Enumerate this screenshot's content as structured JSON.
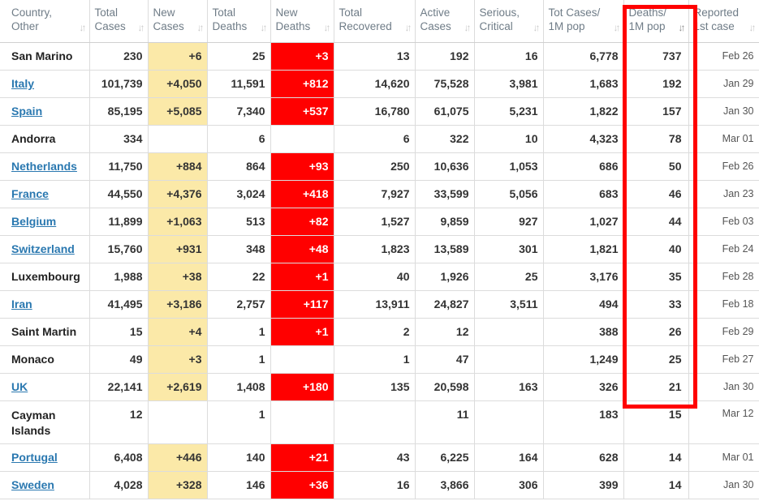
{
  "columns": [
    {
      "key": "country",
      "label": "Country,\nOther"
    },
    {
      "key": "total_cases",
      "label": "Total\nCases"
    },
    {
      "key": "new_cases",
      "label": "New\nCases"
    },
    {
      "key": "total_deaths",
      "label": "Total\nDeaths"
    },
    {
      "key": "new_deaths",
      "label": "New\nDeaths"
    },
    {
      "key": "total_recovered",
      "label": "Total\nRecovered"
    },
    {
      "key": "active_cases",
      "label": "Active\nCases"
    },
    {
      "key": "serious_critical",
      "label": "Serious,\nCritical"
    },
    {
      "key": "tot_cases_1m",
      "label": "Tot Cases/\n1M pop"
    },
    {
      "key": "deaths_1m",
      "label": "Deaths/\n1M pop"
    },
    {
      "key": "reported",
      "label": "Reported\n1st case"
    }
  ],
  "sorted_column": "deaths_1m",
  "highlight_color": "#ff0000",
  "new_cases_color": "#fbe9a8",
  "new_deaths_color": "#ff0000",
  "rows": [
    {
      "country": "San Marino",
      "link": false,
      "total_cases": "230",
      "new_cases": "+6",
      "total_deaths": "25",
      "new_deaths": "+3",
      "total_recovered": "13",
      "active_cases": "192",
      "serious_critical": "16",
      "tot_cases_1m": "6,778",
      "deaths_1m": "737",
      "reported": "Feb 26"
    },
    {
      "country": "Italy",
      "link": true,
      "total_cases": "101,739",
      "new_cases": "+4,050",
      "total_deaths": "11,591",
      "new_deaths": "+812",
      "total_recovered": "14,620",
      "active_cases": "75,528",
      "serious_critical": "3,981",
      "tot_cases_1m": "1,683",
      "deaths_1m": "192",
      "reported": "Jan 29"
    },
    {
      "country": "Spain",
      "link": true,
      "total_cases": "85,195",
      "new_cases": "+5,085",
      "total_deaths": "7,340",
      "new_deaths": "+537",
      "total_recovered": "16,780",
      "active_cases": "61,075",
      "serious_critical": "5,231",
      "tot_cases_1m": "1,822",
      "deaths_1m": "157",
      "reported": "Jan 30"
    },
    {
      "country": "Andorra",
      "link": false,
      "total_cases": "334",
      "new_cases": "",
      "total_deaths": "6",
      "new_deaths": "",
      "total_recovered": "6",
      "active_cases": "322",
      "serious_critical": "10",
      "tot_cases_1m": "4,323",
      "deaths_1m": "78",
      "reported": "Mar 01"
    },
    {
      "country": "Netherlands",
      "link": true,
      "total_cases": "11,750",
      "new_cases": "+884",
      "total_deaths": "864",
      "new_deaths": "+93",
      "total_recovered": "250",
      "active_cases": "10,636",
      "serious_critical": "1,053",
      "tot_cases_1m": "686",
      "deaths_1m": "50",
      "reported": "Feb 26"
    },
    {
      "country": "France",
      "link": true,
      "total_cases": "44,550",
      "new_cases": "+4,376",
      "total_deaths": "3,024",
      "new_deaths": "+418",
      "total_recovered": "7,927",
      "active_cases": "33,599",
      "serious_critical": "5,056",
      "tot_cases_1m": "683",
      "deaths_1m": "46",
      "reported": "Jan 23"
    },
    {
      "country": "Belgium",
      "link": true,
      "total_cases": "11,899",
      "new_cases": "+1,063",
      "total_deaths": "513",
      "new_deaths": "+82",
      "total_recovered": "1,527",
      "active_cases": "9,859",
      "serious_critical": "927",
      "tot_cases_1m": "1,027",
      "deaths_1m": "44",
      "reported": "Feb 03"
    },
    {
      "country": "Switzerland",
      "link": true,
      "total_cases": "15,760",
      "new_cases": "+931",
      "total_deaths": "348",
      "new_deaths": "+48",
      "total_recovered": "1,823",
      "active_cases": "13,589",
      "serious_critical": "301",
      "tot_cases_1m": "1,821",
      "deaths_1m": "40",
      "reported": "Feb 24"
    },
    {
      "country": "Luxembourg",
      "link": false,
      "total_cases": "1,988",
      "new_cases": "+38",
      "total_deaths": "22",
      "new_deaths": "+1",
      "total_recovered": "40",
      "active_cases": "1,926",
      "serious_critical": "25",
      "tot_cases_1m": "3,176",
      "deaths_1m": "35",
      "reported": "Feb 28"
    },
    {
      "country": "Iran",
      "link": true,
      "total_cases": "41,495",
      "new_cases": "+3,186",
      "total_deaths": "2,757",
      "new_deaths": "+117",
      "total_recovered": "13,911",
      "active_cases": "24,827",
      "serious_critical": "3,511",
      "tot_cases_1m": "494",
      "deaths_1m": "33",
      "reported": "Feb 18"
    },
    {
      "country": "Saint Martin",
      "link": false,
      "total_cases": "15",
      "new_cases": "+4",
      "total_deaths": "1",
      "new_deaths": "+1",
      "total_recovered": "2",
      "active_cases": "12",
      "serious_critical": "",
      "tot_cases_1m": "388",
      "deaths_1m": "26",
      "reported": "Feb 29"
    },
    {
      "country": "Monaco",
      "link": false,
      "total_cases": "49",
      "new_cases": "+3",
      "total_deaths": "1",
      "new_deaths": "",
      "total_recovered": "1",
      "active_cases": "47",
      "serious_critical": "",
      "tot_cases_1m": "1,249",
      "deaths_1m": "25",
      "reported": "Feb 27"
    },
    {
      "country": "UK",
      "link": true,
      "total_cases": "22,141",
      "new_cases": "+2,619",
      "total_deaths": "1,408",
      "new_deaths": "+180",
      "total_recovered": "135",
      "active_cases": "20,598",
      "serious_critical": "163",
      "tot_cases_1m": "326",
      "deaths_1m": "21",
      "reported": "Jan 30"
    },
    {
      "country": "Cayman\nIslands",
      "link": false,
      "tall": true,
      "total_cases": "12",
      "new_cases": "",
      "total_deaths": "1",
      "new_deaths": "",
      "total_recovered": "",
      "active_cases": "11",
      "serious_critical": "",
      "tot_cases_1m": "183",
      "deaths_1m": "15",
      "reported": "Mar 12"
    },
    {
      "country": "Portugal",
      "link": true,
      "total_cases": "6,408",
      "new_cases": "+446",
      "total_deaths": "140",
      "new_deaths": "+21",
      "total_recovered": "43",
      "active_cases": "6,225",
      "serious_critical": "164",
      "tot_cases_1m": "628",
      "deaths_1m": "14",
      "reported": "Mar 01"
    },
    {
      "country": "Sweden",
      "link": true,
      "total_cases": "4,028",
      "new_cases": "+328",
      "total_deaths": "146",
      "new_deaths": "+36",
      "total_recovered": "16",
      "active_cases": "3,866",
      "serious_critical": "306",
      "tot_cases_1m": "399",
      "deaths_1m": "14",
      "reported": "Jan 30"
    }
  ]
}
